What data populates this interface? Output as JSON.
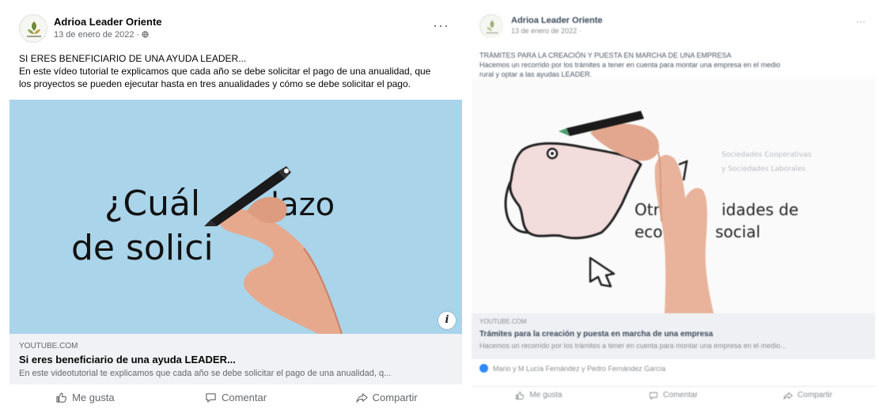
{
  "left_post": {
    "author": "Adrioa Leader Oriente",
    "date": "13 de enero de 2022 · ",
    "privacy_icon": "globe-icon",
    "more_label": "···",
    "text_line1": "SI ERES BENEFICIARIO DE UNA AYUDA LEADER...",
    "text_line2": "En este vídeo tutorial te explicamos que cada año se debe solicitar el pago de una anualidad, que",
    "text_line3": "los proyectos se pueden ejecutar hasta en tres anualidades y cómo se debe solicitar el pago.",
    "video_text_line1": "¿Cuál",
    "video_text_line1b": "lazo",
    "video_text_line2": "de solici",
    "info_label": "i",
    "link_domain": "YOUTUBE.COM",
    "link_title": "Si eres beneficiario de una ayuda LEADER...",
    "link_description": "En este videotutorial te explicamos que cada año se debe solicitar el pago de una anualidad, q...",
    "actions": {
      "like": "Me gusta",
      "comment": "Comentar",
      "share": "Compartir"
    }
  },
  "right_post": {
    "author": "Adrioa Leader Oriente",
    "date": "13 de enero de 2022 ·",
    "more_label": "···",
    "text_line1": "TRÁMITES PARA LA CREACIÓN Y PUESTA EN MARCHA DE UNA EMPRESA",
    "text_line2": "Hacemos un recorrido por los trámites a tener en cuenta para montar una empresa en el medio",
    "text_line3": "rural y optar a las ayudas LEADER.",
    "video_text_line1": "Otras",
    "video_text_line1b": "idades de",
    "video_text_line2": "econ",
    "video_text_line2b": "social",
    "video_side_text1": "Sociedades Cooperativas",
    "video_side_text2": "y Sociedades Laborales",
    "link_domain": "YOUTUBE.COM",
    "link_title": "Trámites para la creación y puesta en marcha de una empresa",
    "link_description": "Hacemos un recorrido por los trámites a tener en cuenta para montar una empresa en el medio...",
    "reactions_text": "Mario y M Lucía Fernández y Pedro Fernández García",
    "actions": {
      "like": "Me gusta",
      "comment": "Comentar",
      "share": "Compartir"
    }
  },
  "colors": {
    "left_video_bg": "#a9d4ea",
    "link_bg": "#f0f2f5",
    "map_fill": "#f3dcdc",
    "accent_blue": "#2e89ff"
  }
}
